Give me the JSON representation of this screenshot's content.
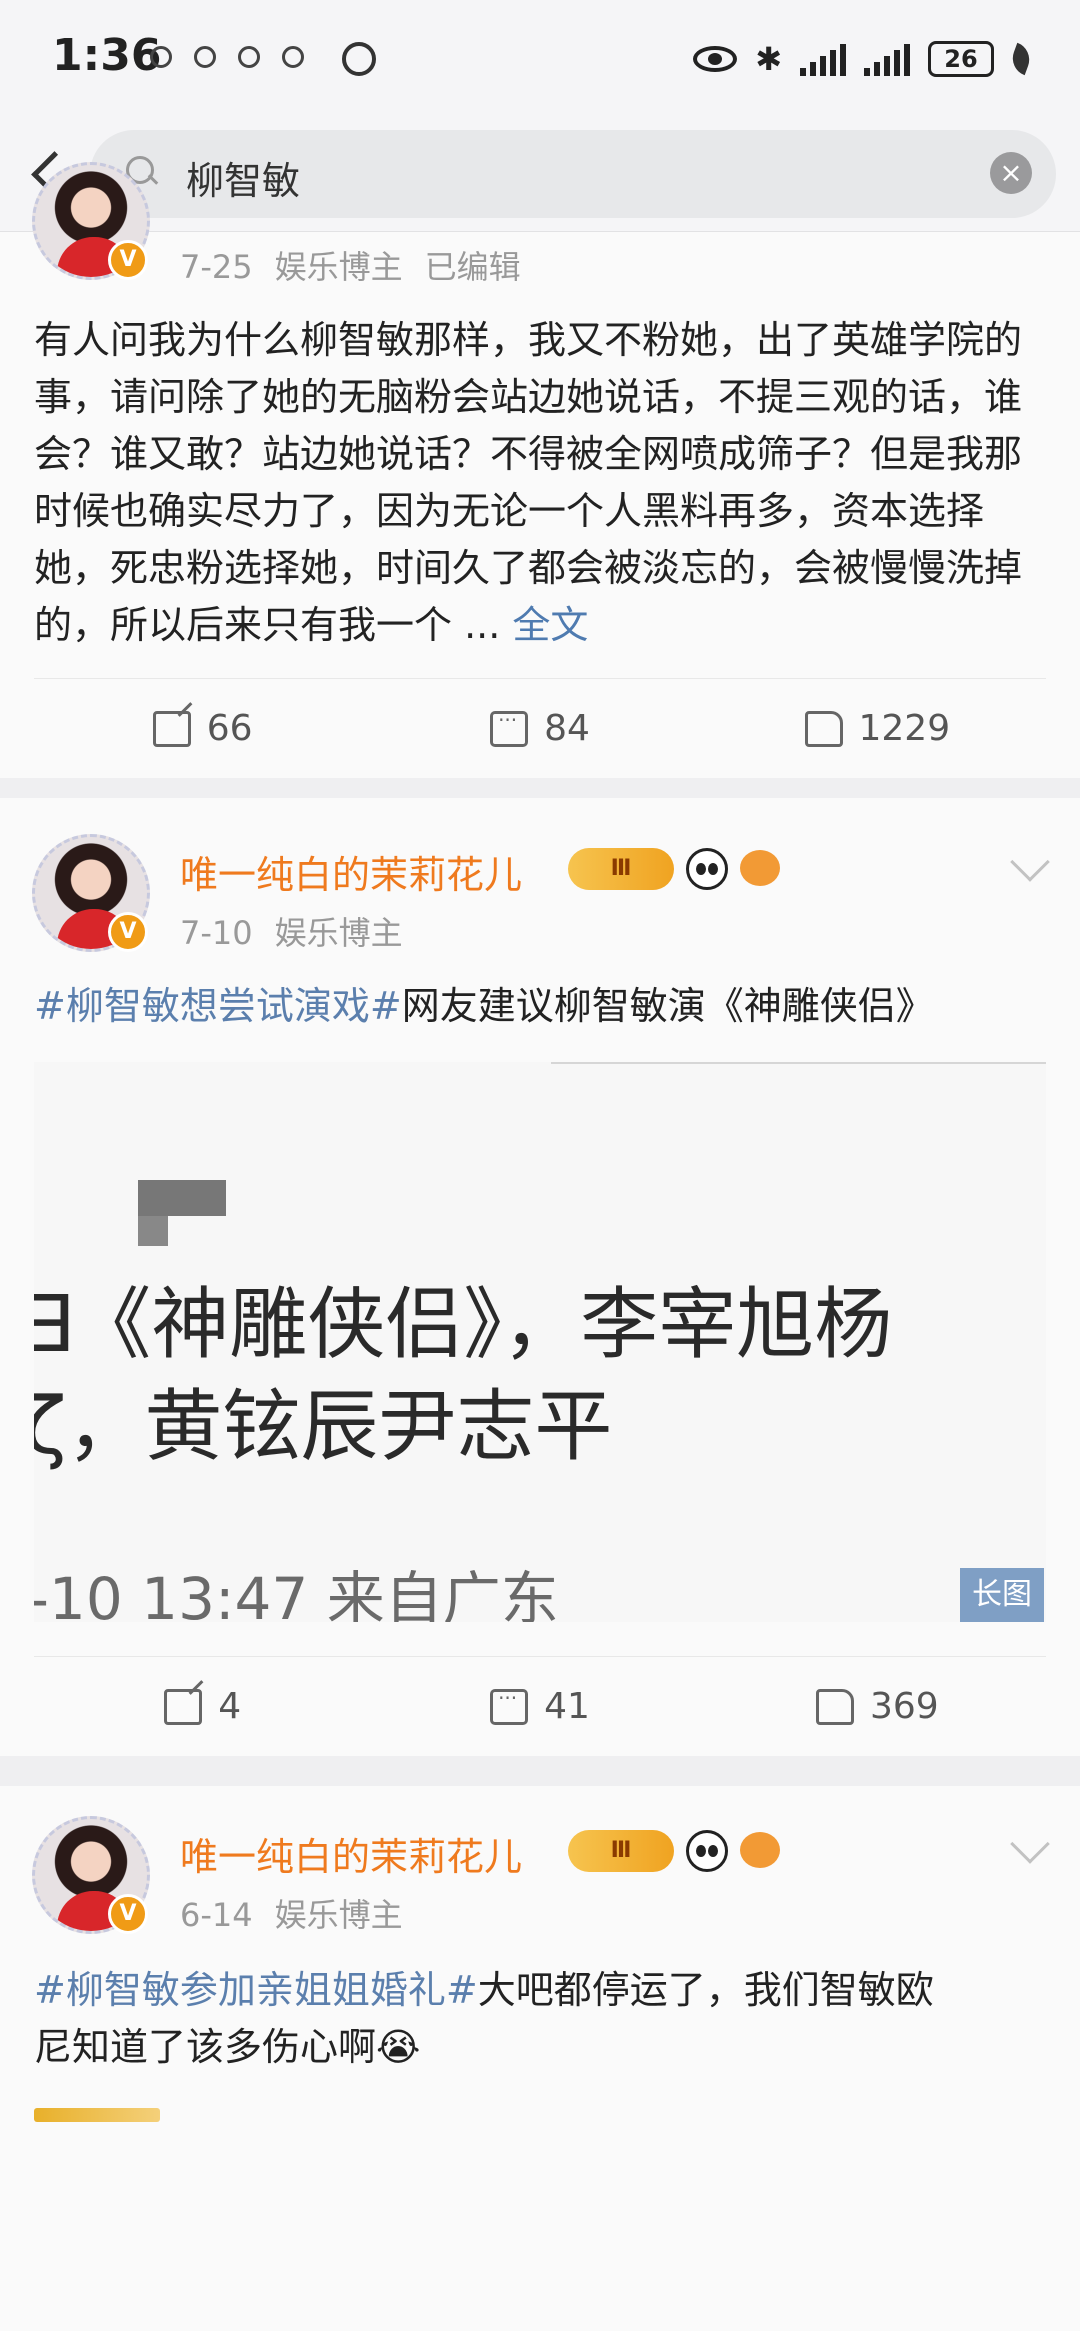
{
  "status_bar": {
    "time": "1:36",
    "battery": "26"
  },
  "search": {
    "query": "柳智敏",
    "clear_icon": "×"
  },
  "posts": [
    {
      "date": "7-25",
      "category": "娱乐博主",
      "edited": "已编辑",
      "text": "有人问我为什么柳智敏那样，我又不粉她，出了英雄学院的事，请问除了她的无脑粉会站边她说话，不提三观的话，谁会？谁又敢？站边她说话？不得被全网喷成筛子？但是我那时候也确实尽力了，因为无论一个人黑料再多，资本选择她，死忠粉选择她，时间久了都会被淡忘的，会被慢慢洗掉的，所以后来只有我一个 ...",
      "full_text": "全文",
      "shares": "66",
      "comments": "84",
      "likes": "1229"
    },
    {
      "username": "唯一纯白的茉莉花儿",
      "vip_level": "Ⅲ",
      "date": "7-10",
      "category": "娱乐博主",
      "hashtag": "#柳智敏想尝试演戏#",
      "text": "网友建议柳智敏演《神雕侠侣》",
      "image_line1": "∃《神雕侠侣》，李宰旭杨",
      "image_line2": "ζ，黄铉辰尹志平",
      "image_line3": "-10 13:47  来自广东",
      "long_image": "长图",
      "shares": "4",
      "comments": "41",
      "likes": "369"
    },
    {
      "username": "唯一纯白的茉莉花儿",
      "vip_level": "Ⅲ",
      "date": "6-14",
      "category": "娱乐博主",
      "hashtag": "#柳智敏参加亲姐姐婚礼#",
      "text_line1": "大吧都停运了，我们智敏欧",
      "text_line2": "尼知道了该多伤心啊😭"
    }
  ],
  "colors": {
    "username": "#ef7a1e",
    "hashtag": "#5b7fad",
    "verified": "#f09b16",
    "long_image_badge": "#7f9fc5"
  }
}
